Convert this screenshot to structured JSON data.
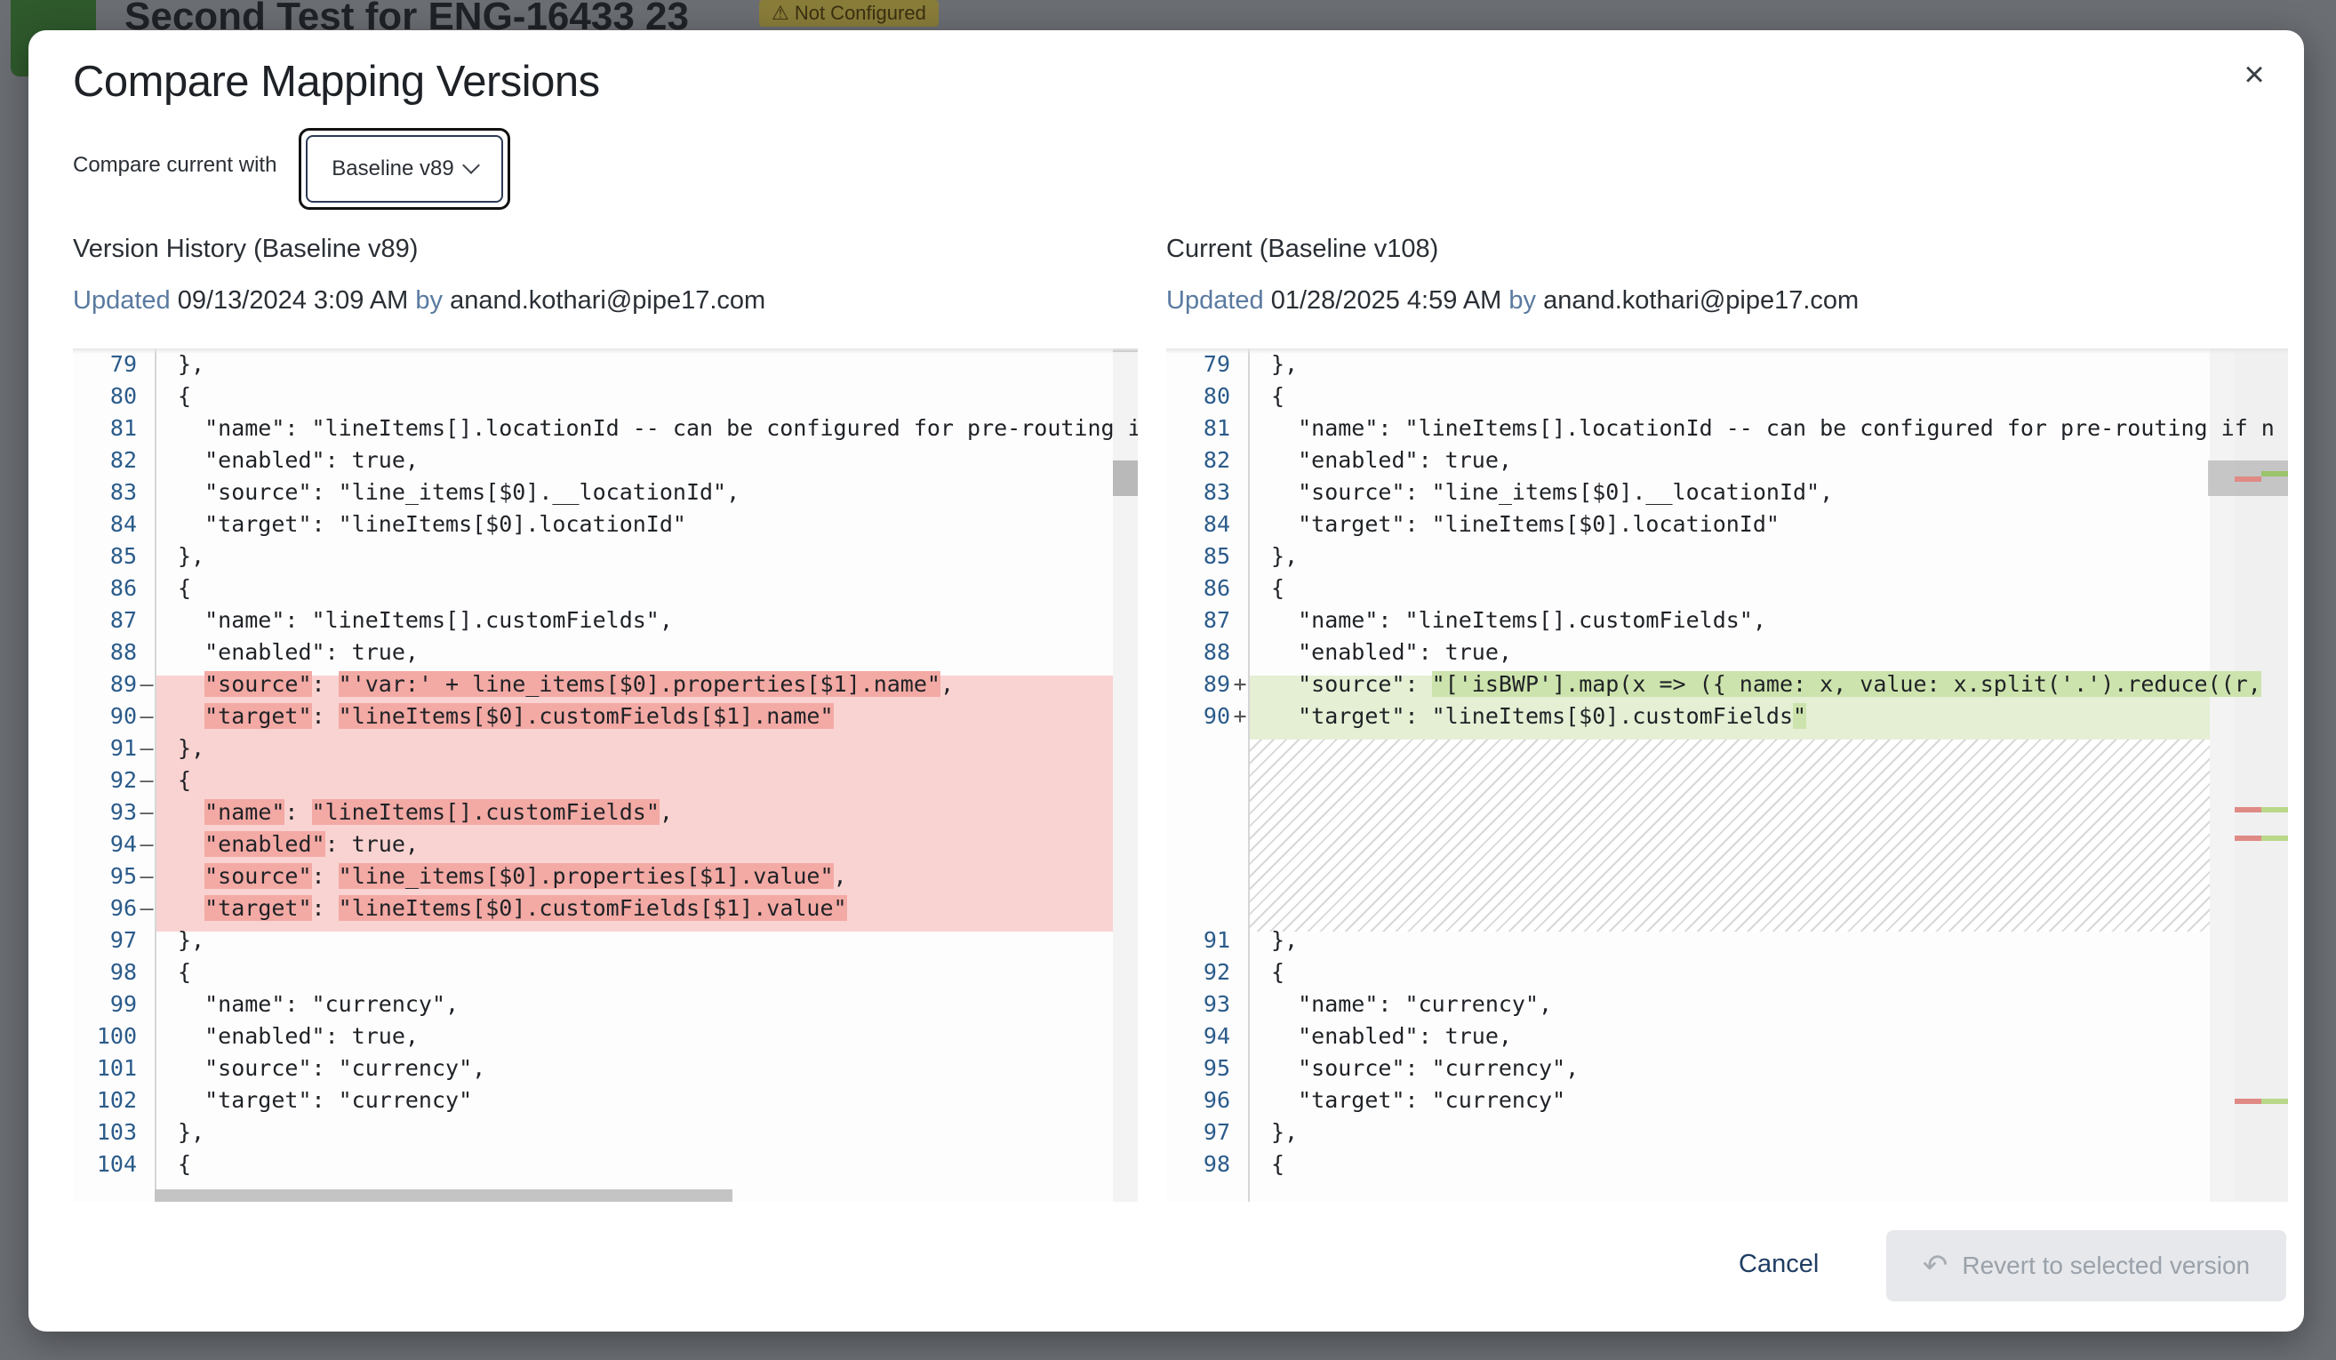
{
  "background": {
    "title": "Second Test for ENG-16433 23",
    "badge": "⚠ Not Configured"
  },
  "modal": {
    "title": "Compare Mapping Versions",
    "compare_label": "Compare current with",
    "compare_selected": "Baseline v89",
    "close_icon": "close-icon",
    "left": {
      "header": "Version History (Baseline v89)",
      "updated_label": "Updated",
      "updated_value": "09/13/2024 3:09 AM",
      "by_label": "by",
      "author": "anand.kothari@pipe17.com"
    },
    "right": {
      "header": "Current (Baseline v108)",
      "updated_label": "Updated",
      "updated_value": "01/28/2025 4:59 AM",
      "by_label": "by",
      "author": "anand.kothari@pipe17.com"
    },
    "cancel_label": "Cancel",
    "revert_label": "Revert to selected version",
    "revert_icon": "undo-icon",
    "colors": {
      "deleted_bg": "#f9d3d1",
      "deleted_word": "#f3a9a4",
      "added_bg": "#e4efd4",
      "added_word": "#cde3ad",
      "line_number": "#2b5b8a"
    }
  },
  "left_lines": [
    {
      "n": "79",
      "mark": "",
      "text": "},"
    },
    {
      "n": "80",
      "mark": "",
      "text": "{"
    },
    {
      "n": "81",
      "mark": "",
      "text": "  \"name\": \"lineItems[].locationId -- can be configured for pre-routing if n"
    },
    {
      "n": "82",
      "mark": "",
      "text": "  \"enabled\": true,"
    },
    {
      "n": "83",
      "mark": "",
      "text": "  \"source\": \"line_items[$0].__locationId\","
    },
    {
      "n": "84",
      "mark": "",
      "text": "  \"target\": \"lineItems[$0].locationId\""
    },
    {
      "n": "85",
      "mark": "",
      "text": "},"
    },
    {
      "n": "86",
      "mark": "",
      "text": "{"
    },
    {
      "n": "87",
      "mark": "",
      "text": "  \"name\": \"lineItems[].customFields\","
    },
    {
      "n": "88",
      "mark": "",
      "text": "  \"enabled\": true,"
    },
    {
      "n": "89",
      "mark": "—",
      "text": "  \"source\": \"'var:' + line_items[$0].properties[$1].name\","
    },
    {
      "n": "90",
      "mark": "—",
      "text": "  \"target\": \"lineItems[$0].customFields[$1].name\""
    },
    {
      "n": "91",
      "mark": "—",
      "text": "},"
    },
    {
      "n": "92",
      "mark": "—",
      "text": "{"
    },
    {
      "n": "93",
      "mark": "—",
      "text": "  \"name\": \"lineItems[].customFields\","
    },
    {
      "n": "94",
      "mark": "—",
      "text": "  \"enabled\": true,"
    },
    {
      "n": "95",
      "mark": "—",
      "text": "  \"source\": \"line_items[$0].properties[$1].value\","
    },
    {
      "n": "96",
      "mark": "—",
      "text": "  \"target\": \"lineItems[$0].customFields[$1].value\""
    },
    {
      "n": "97",
      "mark": "",
      "text": "},"
    },
    {
      "n": "98",
      "mark": "",
      "text": "{"
    },
    {
      "n": "99",
      "mark": "",
      "text": "  \"name\": \"currency\","
    },
    {
      "n": "100",
      "mark": "",
      "text": "  \"enabled\": true,"
    },
    {
      "n": "101",
      "mark": "",
      "text": "  \"source\": \"currency\","
    },
    {
      "n": "102",
      "mark": "",
      "text": "  \"target\": \"currency\""
    },
    {
      "n": "103",
      "mark": "",
      "text": "},"
    },
    {
      "n": "104",
      "mark": "",
      "text": "{"
    }
  ],
  "right_lines": [
    {
      "n": "79",
      "mark": "",
      "text": "},"
    },
    {
      "n": "80",
      "mark": "",
      "text": "{"
    },
    {
      "n": "81",
      "mark": "",
      "text": "  \"name\": \"lineItems[].locationId -- can be configured for pre-routing if n"
    },
    {
      "n": "82",
      "mark": "",
      "text": "  \"enabled\": true,"
    },
    {
      "n": "83",
      "mark": "",
      "text": "  \"source\": \"line_items[$0].__locationId\","
    },
    {
      "n": "84",
      "mark": "",
      "text": "  \"target\": \"lineItems[$0].locationId\""
    },
    {
      "n": "85",
      "mark": "",
      "text": "},"
    },
    {
      "n": "86",
      "mark": "",
      "text": "{"
    },
    {
      "n": "87",
      "mark": "",
      "text": "  \"name\": \"lineItems[].customFields\","
    },
    {
      "n": "88",
      "mark": "",
      "text": "  \"enabled\": true,"
    },
    {
      "n": "89",
      "mark": "+",
      "text": "  \"source\": \"['isBWP'].map(x => ({ name: x, value: x.split('.').reduce((r,"
    },
    {
      "n": "90",
      "mark": "+",
      "text": "  \"target\": \"lineItems[$0].customFields\""
    },
    {
      "n": "91",
      "mark": "",
      "text": "},"
    },
    {
      "n": "92",
      "mark": "",
      "text": "{"
    },
    {
      "n": "93",
      "mark": "",
      "text": "  \"name\": \"currency\","
    },
    {
      "n": "94",
      "mark": "",
      "text": "  \"enabled\": true,"
    },
    {
      "n": "95",
      "mark": "",
      "text": "  \"source\": \"currency\","
    },
    {
      "n": "96",
      "mark": "",
      "text": "  \"target\": \"currency\""
    },
    {
      "n": "97",
      "mark": "",
      "text": "},"
    },
    {
      "n": "98",
      "mark": "",
      "text": "{"
    }
  ]
}
